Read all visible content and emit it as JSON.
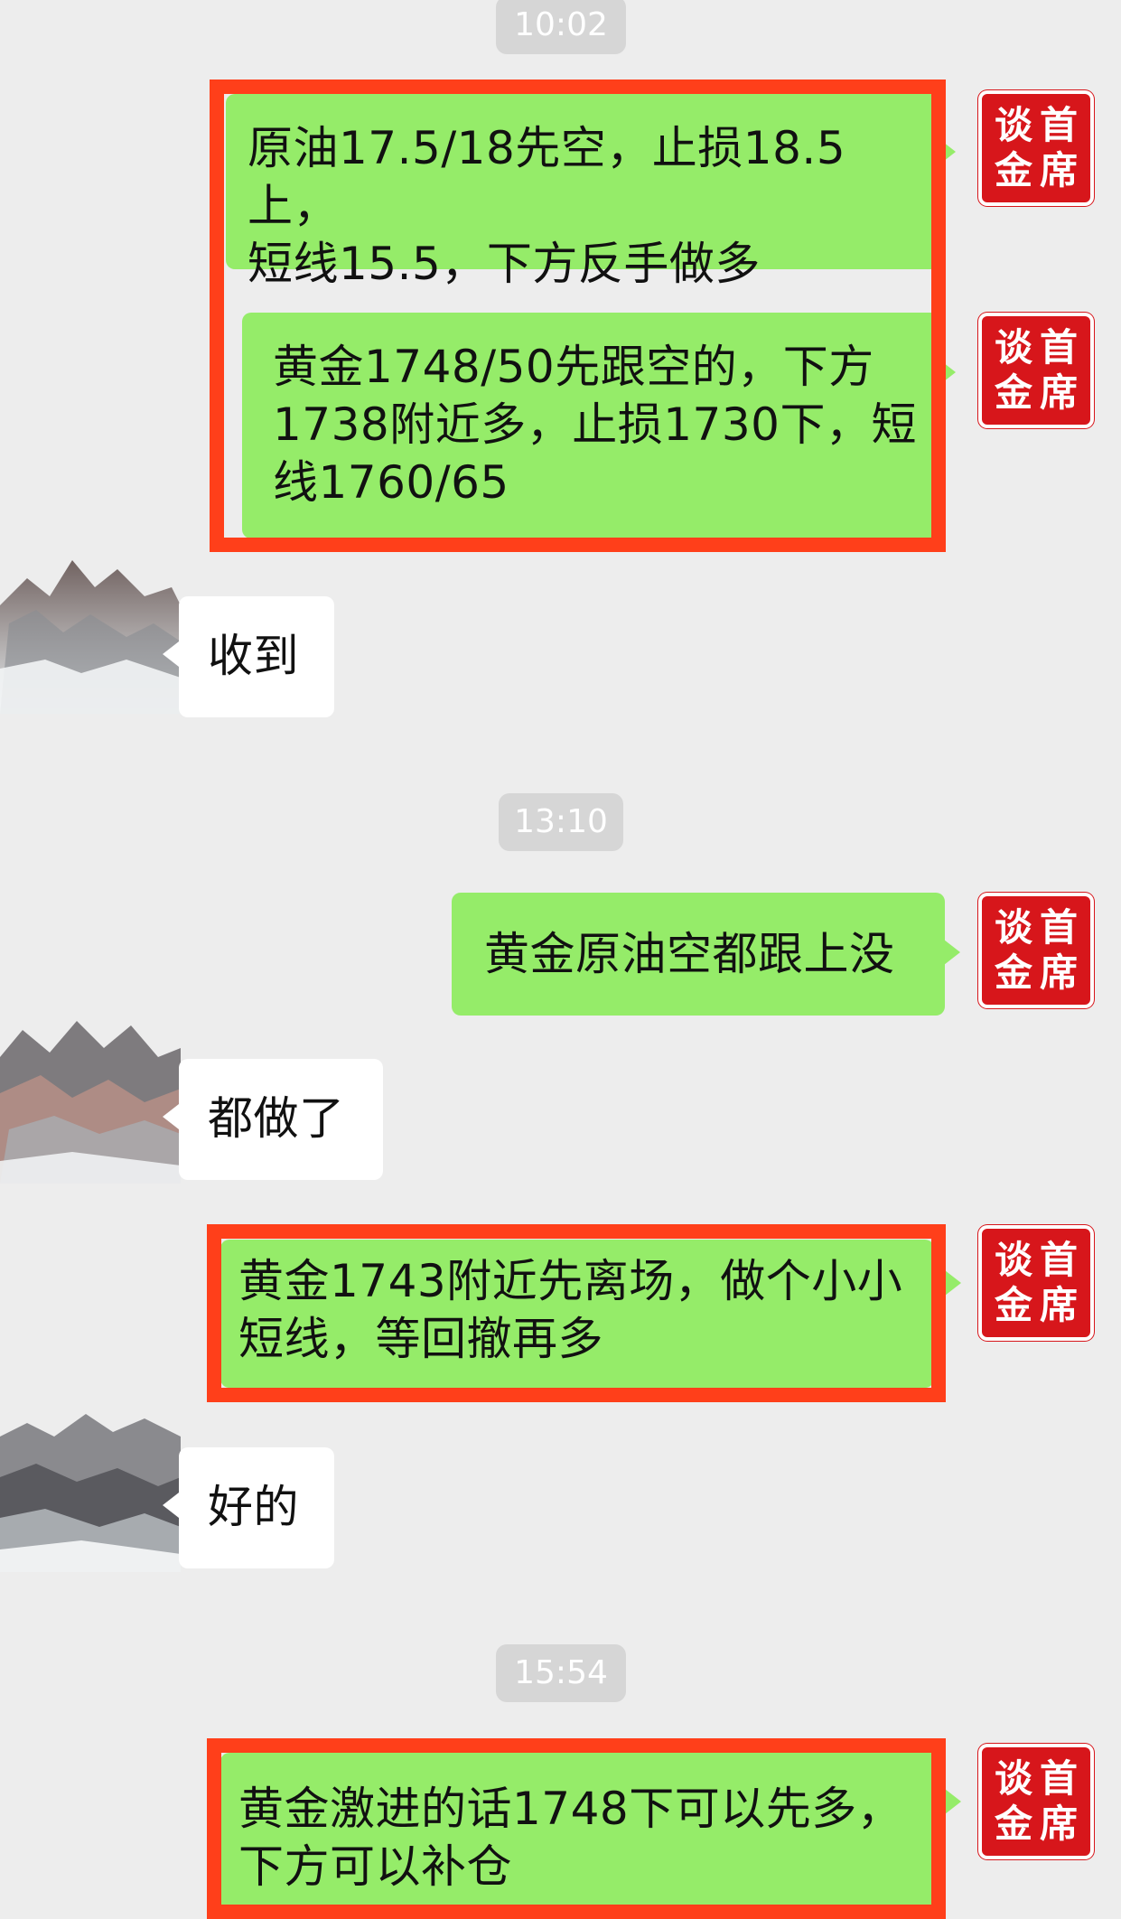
{
  "chat": {
    "timestamps": [
      "10:02",
      "13:10",
      "15:54"
    ],
    "messages": [
      {
        "sender": "me",
        "text": "原油17.5/18先空，止损18.5上，\n短线15.5，下方反手做多"
      },
      {
        "sender": "me",
        "text": "黄金1748/50先跟空的，下方\n1738附近多，止损1730下，短\n线1760/65"
      },
      {
        "sender": "other",
        "text": "收到"
      },
      {
        "sender": "me",
        "text": "黄金原油空都跟上没"
      },
      {
        "sender": "other",
        "text": "都做了"
      },
      {
        "sender": "me",
        "text": "黄金1743附近先离场，做个小小\n短线，等回撤再多"
      },
      {
        "sender": "other",
        "text": "好的"
      },
      {
        "sender": "me",
        "text": "黄金激进的话1748下可以先多，\n下方可以补仓"
      }
    ]
  },
  "avatar": {
    "seal_text": [
      "谈",
      "首",
      "金",
      "席"
    ]
  },
  "colors": {
    "background": "#ededed",
    "my_bubble": "#95ec69",
    "other_bubble": "#ffffff",
    "highlight_frame": "#ff3f1a",
    "seal_red": "#d7161b",
    "timestamp_bg": "#d6d6d6"
  }
}
